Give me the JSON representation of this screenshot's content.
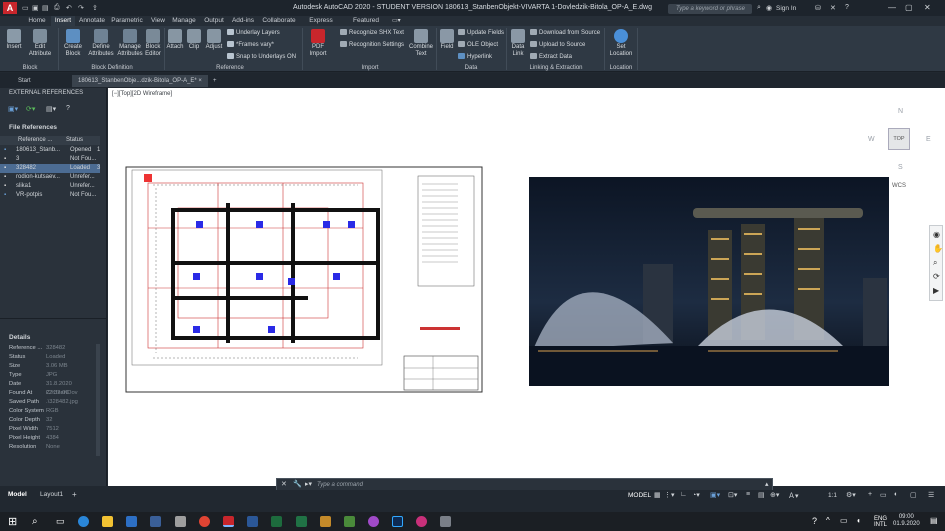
{
  "titlebar": {
    "logo": "A",
    "title": "Autodesk AutoCAD 2020 - STUDENT VERSION    180613_StanbenObjekt-VIVARTA 1-Dovledzik-Bitola_OP-A_E.dwg",
    "search_placeholder": "Type a keyword or phrase",
    "signin": "Sign In"
  },
  "ribbon_tabs": [
    "Home",
    "Insert",
    "Annotate",
    "Parametric",
    "View",
    "Manage",
    "Output",
    "Add-ins",
    "Collaborate",
    "Express Tools",
    "Featured Apps"
  ],
  "ribbon": {
    "block": {
      "insert": "Insert",
      "edit_attribute": "Edit Attribute",
      "panel": "Block"
    },
    "block_def": {
      "create": "Create Block",
      "define": "Define Attributes",
      "manage": "Manage Attributes",
      "editor": "Block Editor",
      "panel": "Block Definition"
    },
    "reference": {
      "attach": "Attach",
      "clip": "Clip",
      "adjust": "Adjust",
      "underlay": "Underlay Layers",
      "frames": "*Frames vary*",
      "snap": "Snap to Underlays ON",
      "panel": "Reference"
    },
    "import": {
      "pdf": "PDF Import",
      "recognize_shx": "Recognize SHX Text",
      "recognition_settings": "Recognition Settings",
      "combine": "Combine Text",
      "panel": "Import"
    },
    "data": {
      "field": "Field",
      "update_fields": "Update Fields",
      "ole": "OLE Object",
      "hyperlink": "Hyperlink",
      "panel": "Data"
    },
    "linking": {
      "data_link": "Data Link",
      "download": "Download from Source",
      "upload": "Upload to Source",
      "extract": "Extract Data",
      "panel": "Linking & Extraction"
    },
    "location": {
      "set": "Set Location",
      "panel": "Location"
    }
  },
  "doc_tabs": {
    "start": "Start",
    "file": "180613_StanbenObje...dzik-Bitola_OP-A_E*",
    "close": "×",
    "add": "+"
  },
  "xref_panel": {
    "title": "EXTERNAL REFERENCES",
    "file_refs": "File References",
    "col_ref": "Reference ...",
    "col_status": "Status",
    "rows": [
      {
        "name": "180613_Stanb...",
        "status": "Opened",
        "extra": "1"
      },
      {
        "name": "3",
        "status": "Not Fou...",
        "extra": ""
      },
      {
        "name": "328482",
        "status": "Loaded",
        "extra": "3"
      },
      {
        "name": "rodion-kutsaev...",
        "status": "Unrefer...",
        "extra": ""
      },
      {
        "name": "slika1",
        "status": "Unrefer...",
        "extra": ""
      },
      {
        "name": "VR-potpis",
        "status": "Not Fou...",
        "extra": ""
      }
    ],
    "details_title": "Details",
    "details": [
      {
        "k": "Reference ...",
        "v": "328482"
      },
      {
        "k": "Status",
        "v": "Loaded"
      },
      {
        "k": "Size",
        "v": "3.06 MB"
      },
      {
        "k": "Type",
        "v": "JPG"
      },
      {
        "k": "Date",
        "v": "31.8.2020 22:32:06"
      },
      {
        "k": "Found At",
        "v": "C:\\User\\Dov"
      },
      {
        "k": "Saved Path",
        "v": ".\\328482.jpg"
      },
      {
        "k": "Color System",
        "v": "RGB"
      },
      {
        "k": "Color Depth",
        "v": "32"
      },
      {
        "k": "Pixel Width",
        "v": "7512"
      },
      {
        "k": "Pixel Height",
        "v": "4384"
      },
      {
        "k": "Resolution",
        "v": "None"
      }
    ]
  },
  "viewport_label": "[−][Top][2D Wireframe]",
  "viewcube": {
    "n": "N",
    "s": "S",
    "e": "E",
    "w": "W",
    "top": "TOP",
    "wcs": "WCS"
  },
  "command": {
    "placeholder": "Type a command"
  },
  "layout_tabs": [
    "Model",
    "Layout1",
    "+"
  ],
  "status": {
    "model": "MODEL",
    "scale": "1:1"
  },
  "clock": {
    "lang": "ENG",
    "intl": "INTL",
    "time": "09:00",
    "date": "01.9.2020"
  },
  "colors": {
    "accent": "#c8262c",
    "panel": "#2a323b",
    "ribbon": "#2f3944",
    "selection": "#4c6c93"
  }
}
